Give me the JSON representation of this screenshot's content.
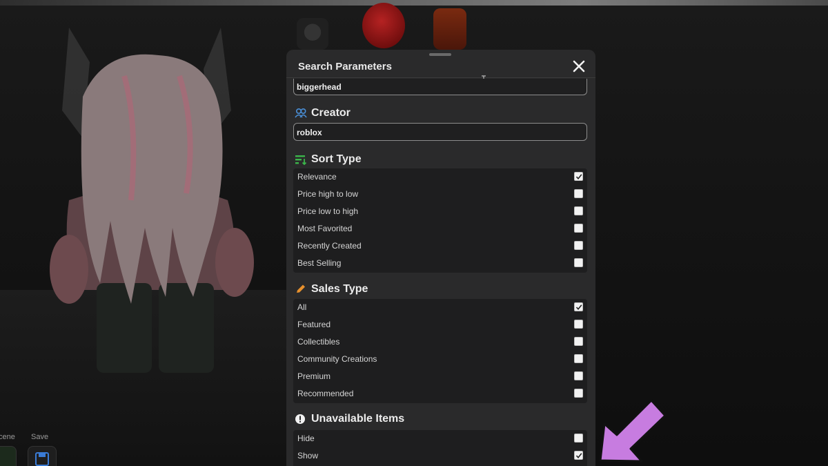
{
  "panel": {
    "title": "Search Parameters",
    "close_icon": "close-icon",
    "keyword_value": "biggerhead"
  },
  "creator": {
    "title": "Creator",
    "icon": "people-icon",
    "value": "roblox"
  },
  "sort_type": {
    "title": "Sort Type",
    "icon": "sort-icon",
    "options": [
      {
        "label": "Relevance",
        "checked": true
      },
      {
        "label": "Price high to low",
        "checked": false
      },
      {
        "label": "Price low to high",
        "checked": false
      },
      {
        "label": "Most Favorited",
        "checked": false
      },
      {
        "label": "Recently Created",
        "checked": false
      },
      {
        "label": "Best Selling",
        "checked": false
      }
    ]
  },
  "sales_type": {
    "title": "Sales Type",
    "icon": "pencil-icon",
    "options": [
      {
        "label": "All",
        "checked": true
      },
      {
        "label": "Featured",
        "checked": false
      },
      {
        "label": "Collectibles",
        "checked": false
      },
      {
        "label": "Community Creations",
        "checked": false
      },
      {
        "label": "Premium",
        "checked": false
      },
      {
        "label": "Recommended",
        "checked": false
      }
    ]
  },
  "unavailable_items": {
    "title": "Unavailable Items",
    "icon": "alert-icon",
    "options": [
      {
        "label": "Hide",
        "checked": false
      },
      {
        "label": "Show",
        "checked": true
      }
    ]
  },
  "bottom_bar": {
    "scene_label": "cene",
    "save_label": "Save"
  },
  "colors": {
    "panel_bg": "#2a2a2b",
    "creator_icon": "#4a90d9",
    "sort_icon": "#3bb54a",
    "sales_icon": "#e8912d",
    "arrow": "#c77ce0"
  }
}
